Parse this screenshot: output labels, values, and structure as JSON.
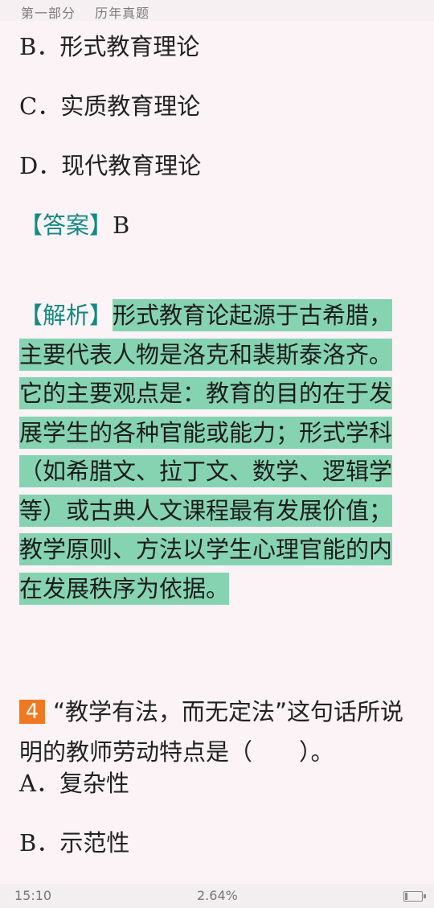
{
  "header": {
    "section": "第一部分",
    "subsection": "历年真题"
  },
  "options_prev": [
    {
      "letter": "B",
      "sep": "．",
      "text": "形式教育理论"
    },
    {
      "letter": "C",
      "sep": "．",
      "text": "实质教育理论"
    },
    {
      "letter": "D",
      "sep": "．",
      "text": "现代教育理论"
    }
  ],
  "answer": {
    "label": "【答案】",
    "value": "B"
  },
  "analysis": {
    "label": "【解析】",
    "text": "形式教育论起源于古希腊，主要代表人物是洛克和裴斯泰洛齐。它的主要观点是：教育的目的在于发展学生的各种官能或能力；形式学科（如希腊文、拉丁文、数学、逻辑学等）或古典人文课程最有发展价值；教学原则、方法以学生心理官能的内在发展秩序为依据。"
  },
  "question": {
    "number": "4",
    "text": "“教学有法，而无定法”这句话所说明的教师劳动特点是（　　）。"
  },
  "options_next": [
    {
      "letter": "A",
      "sep": "．",
      "text": "复杂性"
    },
    {
      "letter": "B",
      "sep": "．",
      "text": "示范性"
    }
  ],
  "status": {
    "time": "15:10",
    "progress": "2.64%",
    "battery_level": 0.15
  },
  "colors": {
    "teal": "#148a82",
    "highlight": "#86d3b2",
    "badge": "#f07820"
  }
}
